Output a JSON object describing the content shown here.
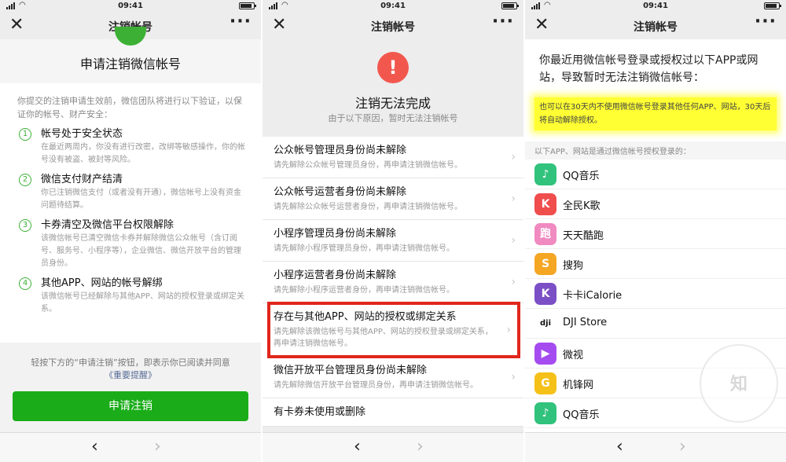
{
  "status": {
    "time": "09:41"
  },
  "panel1": {
    "nav_title": "注销帐号",
    "heading": "申请注销微信帐号",
    "intro": "你提交的注销申请生效前，微信团队将进行以下验证，以保证你的帐号、财产安全：",
    "steps": [
      {
        "num": "1",
        "title": "帐号处于安全状态",
        "desc": "在最近两周内，你没有进行改密，改绑等敏感操作，你的帐号没有被盗、被封等风险。"
      },
      {
        "num": "2",
        "title": "微信支付财产结清",
        "desc": "你已注销微信支付（或者没有开通），微信帐号上没有资金问题待结算。"
      },
      {
        "num": "3",
        "title": "卡券清空及微信平台权限解除",
        "desc": "该微信帐号已清空微信卡券并解除微信公众帐号（含订阅号、服务号、小程序等），企业微信、微信开放平台的管理员身份。"
      },
      {
        "num": "4",
        "title": "其他APP、网站的帐号解绑",
        "desc": "该微信帐号已经解除与其他APP、网站的授权登录或绑定关系。"
      }
    ],
    "footer_note": "轻按下方的“申请注销”按钮，即表示你已阅读并同意",
    "footer_link": "《重要提醒》",
    "apply_button": "申请注销"
  },
  "panel2": {
    "nav_title": "注销帐号",
    "alert_icon": "!",
    "heading": "注销无法完成",
    "subheading": "由于以下原因，暂时无法注销帐号",
    "reasons": [
      {
        "title": "公众帐号管理员身份尚未解除",
        "desc": "请先解除公众帐号管理员身份，再申请注销微信帐号。"
      },
      {
        "title": "公众帐号运营者身份尚未解除",
        "desc": "请先解除公众帐号运营者身份，再申请注销微信帐号。"
      },
      {
        "title": "小程序管理员身份尚未解除",
        "desc": "请先解除小程序管理员身份，再申请注销微信帐号。"
      },
      {
        "title": "小程序运营者身份尚未解除",
        "desc": "请先解除小程序运营者身份，再申请注销微信帐号。"
      },
      {
        "title": "存在与其他APP、网站的授权或绑定关系",
        "desc": "请先解除该微信帐号与其他APP、网站的授权登录或绑定关系，再申请注销微信帐号。"
      },
      {
        "title": "微信开放平台管理员身份尚未解除",
        "desc": "请先解除微信开放平台管理员身份，再申请注销微信帐号。"
      },
      {
        "title": "有卡券未使用或删除",
        "desc": ""
      }
    ]
  },
  "panel3": {
    "nav_title": "注销帐号",
    "intro": "你最近用微信帐号登录或授权过以下APP或网站，导致暂时无法注销微信帐号：",
    "highlight": "也可以在30天内不使用微信帐号登录其他任何APP、网站，30天后将自动解除授权。",
    "section_label": "以下APP、网站是通过微信帐号授权登录的：",
    "apps": [
      {
        "name": "QQ音乐",
        "icon": "qq-music-icon",
        "glyph": "♪",
        "color": "#31c27c"
      },
      {
        "name": "全民K歌",
        "icon": "quanmin-ksong-icon",
        "glyph": "K",
        "color": "#f04d4d"
      },
      {
        "name": "天天酷跑",
        "icon": "tiantian-kupao-icon",
        "glyph": "跑",
        "color": "#f08ac0"
      },
      {
        "name": "搜狗",
        "icon": "sogou-icon",
        "glyph": "S",
        "color": "#f5a623"
      },
      {
        "name": "卡卡iCalorie",
        "icon": "kaka-icalorie-icon",
        "glyph": "K",
        "color": "#7b4fc6"
      },
      {
        "name": "DJI Store",
        "icon": "dji-store-icon",
        "glyph": "dji",
        "color": "#ffffff"
      },
      {
        "name": "微视",
        "icon": "weishi-icon",
        "glyph": "▶",
        "color": "#a54cf0"
      },
      {
        "name": "机锋网",
        "icon": "jifeng-icon",
        "glyph": "G",
        "color": "#f5c018"
      },
      {
        "name": "QQ音乐",
        "icon": "qq-music-icon",
        "glyph": "♪",
        "color": "#31c27c"
      }
    ]
  }
}
